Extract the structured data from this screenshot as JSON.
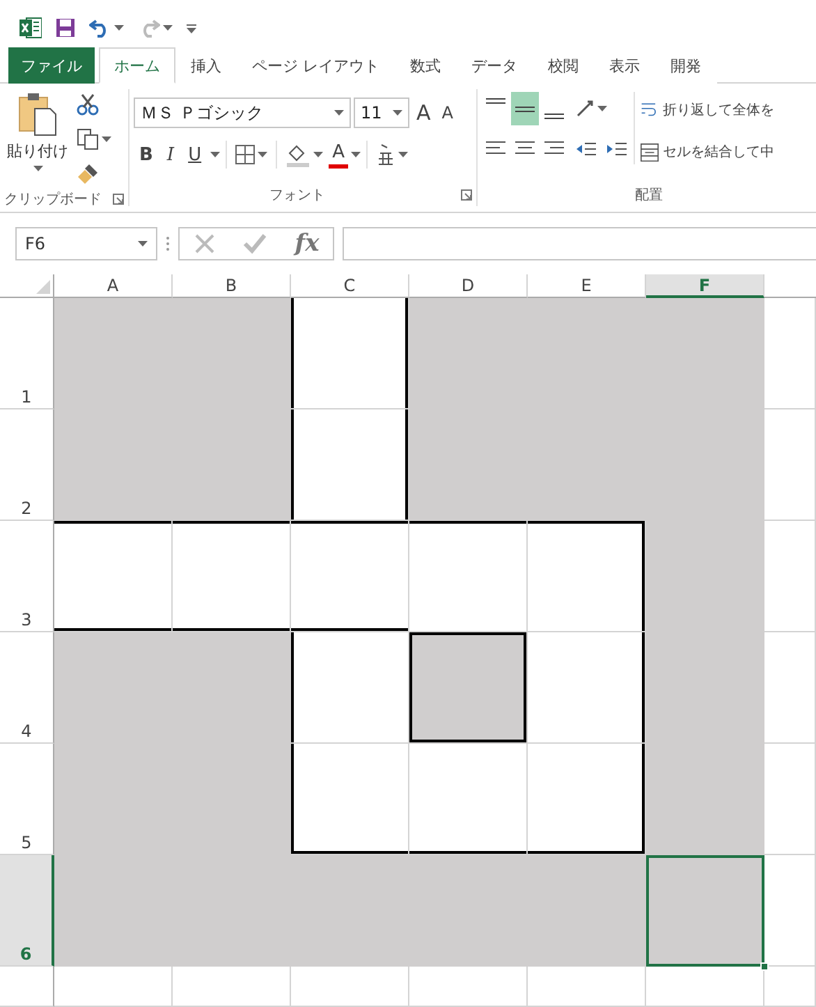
{
  "tabs": [
    {
      "label": "ファイル",
      "kind": "file",
      "selected": false
    },
    {
      "label": "ホーム",
      "kind": "tab",
      "selected": true
    },
    {
      "label": "挿入",
      "kind": "tab",
      "selected": false
    },
    {
      "label": "ページ レイアウト",
      "kind": "tab",
      "selected": false
    },
    {
      "label": "数式",
      "kind": "tab",
      "selected": false
    },
    {
      "label": "データ",
      "kind": "tab",
      "selected": false
    },
    {
      "label": "校閲",
      "kind": "tab",
      "selected": false
    },
    {
      "label": "表示",
      "kind": "tab",
      "selected": false
    },
    {
      "label": "開発",
      "kind": "tab",
      "selected": false
    }
  ],
  "clipboard": {
    "paste_label": "貼り付け",
    "group_label": "クリップボード"
  },
  "font": {
    "font_name": "ＭＳ Ｐゴシック",
    "font_size": "11",
    "grow": "A",
    "shrink": "A",
    "styles": [
      "B",
      "I",
      "U"
    ],
    "font_color_letter": "A",
    "group_label": "フォント"
  },
  "alignment": {
    "vertical": [
      {
        "selected": false
      },
      {
        "selected": true
      },
      {
        "selected": false
      }
    ],
    "wrap_text": "折り返して全体を",
    "merge_center": "セルを結合して中",
    "group_label": "配置"
  },
  "formula_bar": {
    "name_box": "F6",
    "function_label": "fx"
  },
  "columns": [
    {
      "label": "A",
      "selected": false
    },
    {
      "label": "B",
      "selected": false
    },
    {
      "label": "C",
      "selected": false
    },
    {
      "label": "D",
      "selected": false
    },
    {
      "label": "E",
      "selected": false
    },
    {
      "label": "F",
      "selected": true
    }
  ],
  "rows": [
    {
      "header": "1",
      "selected": false,
      "cells": [
        {
          "shaded": true,
          "selected": false,
          "border_top": false,
          "border_right": false,
          "border_bottom": false,
          "border_left": false
        },
        {
          "shaded": true,
          "selected": false,
          "border_top": false,
          "border_right": false,
          "border_bottom": false,
          "border_left": false
        },
        {
          "shaded": false,
          "selected": false,
          "border_top": false,
          "border_right": true,
          "border_bottom": false,
          "border_left": true
        },
        {
          "shaded": true,
          "selected": false,
          "border_top": false,
          "border_right": false,
          "border_bottom": false,
          "border_left": false
        },
        {
          "shaded": true,
          "selected": false,
          "border_top": false,
          "border_right": false,
          "border_bottom": false,
          "border_left": false
        },
        {
          "shaded": true,
          "selected": false,
          "border_top": false,
          "border_right": false,
          "border_bottom": false,
          "border_left": false
        }
      ]
    },
    {
      "header": "2",
      "selected": false,
      "cells": [
        {
          "shaded": true,
          "selected": false,
          "border_top": false,
          "border_right": false,
          "border_bottom": false,
          "border_left": false
        },
        {
          "shaded": true,
          "selected": false,
          "border_top": false,
          "border_right": false,
          "border_bottom": false,
          "border_left": false
        },
        {
          "shaded": false,
          "selected": false,
          "border_top": false,
          "border_right": true,
          "border_bottom": false,
          "border_left": true
        },
        {
          "shaded": true,
          "selected": false,
          "border_top": false,
          "border_right": false,
          "border_bottom": false,
          "border_left": false
        },
        {
          "shaded": true,
          "selected": false,
          "border_top": false,
          "border_right": false,
          "border_bottom": false,
          "border_left": false
        },
        {
          "shaded": true,
          "selected": false,
          "border_top": false,
          "border_right": false,
          "border_bottom": false,
          "border_left": false
        }
      ]
    },
    {
      "header": "3",
      "selected": false,
      "cells": [
        {
          "shaded": false,
          "selected": false,
          "border_top": true,
          "border_right": false,
          "border_bottom": true,
          "border_left": false
        },
        {
          "shaded": false,
          "selected": false,
          "border_top": true,
          "border_right": false,
          "border_bottom": true,
          "border_left": false
        },
        {
          "shaded": false,
          "selected": false,
          "border_top": true,
          "border_right": false,
          "border_bottom": true,
          "border_left": false
        },
        {
          "shaded": false,
          "selected": false,
          "border_top": true,
          "border_right": false,
          "border_bottom": false,
          "border_left": false
        },
        {
          "shaded": false,
          "selected": false,
          "border_top": true,
          "border_right": true,
          "border_bottom": false,
          "border_left": false
        },
        {
          "shaded": true,
          "selected": false,
          "border_top": false,
          "border_right": false,
          "border_bottom": false,
          "border_left": false
        }
      ]
    },
    {
      "header": "4",
      "selected": false,
      "cells": [
        {
          "shaded": true,
          "selected": false,
          "border_top": false,
          "border_right": false,
          "border_bottom": false,
          "border_left": false
        },
        {
          "shaded": true,
          "selected": false,
          "border_top": false,
          "border_right": false,
          "border_bottom": false,
          "border_left": false
        },
        {
          "shaded": false,
          "selected": false,
          "border_top": false,
          "border_right": false,
          "border_bottom": false,
          "border_left": true
        },
        {
          "shaded": true,
          "selected": false,
          "border_top": true,
          "border_right": true,
          "border_bottom": true,
          "border_left": true
        },
        {
          "shaded": false,
          "selected": false,
          "border_top": false,
          "border_right": true,
          "border_bottom": false,
          "border_left": false
        },
        {
          "shaded": true,
          "selected": false,
          "border_top": false,
          "border_right": false,
          "border_bottom": false,
          "border_left": false
        }
      ]
    },
    {
      "header": "5",
      "selected": false,
      "cells": [
        {
          "shaded": true,
          "selected": false,
          "border_top": false,
          "border_right": false,
          "border_bottom": false,
          "border_left": false
        },
        {
          "shaded": true,
          "selected": false,
          "border_top": false,
          "border_right": false,
          "border_bottom": false,
          "border_left": false
        },
        {
          "shaded": false,
          "selected": false,
          "border_top": false,
          "border_right": false,
          "border_bottom": true,
          "border_left": true
        },
        {
          "shaded": false,
          "selected": false,
          "border_top": false,
          "border_right": false,
          "border_bottom": true,
          "border_left": false
        },
        {
          "shaded": false,
          "selected": false,
          "border_top": false,
          "border_right": true,
          "border_bottom": true,
          "border_left": false
        },
        {
          "shaded": true,
          "selected": false,
          "border_top": false,
          "border_right": false,
          "border_bottom": false,
          "border_left": false
        }
      ]
    },
    {
      "header": "6",
      "selected": true,
      "cells": [
        {
          "shaded": true,
          "selected": false,
          "border_top": false,
          "border_right": false,
          "border_bottom": false,
          "border_left": false
        },
        {
          "shaded": true,
          "selected": false,
          "border_top": false,
          "border_right": false,
          "border_bottom": false,
          "border_left": false
        },
        {
          "shaded": true,
          "selected": false,
          "border_top": false,
          "border_right": false,
          "border_bottom": false,
          "border_left": false
        },
        {
          "shaded": true,
          "selected": false,
          "border_top": false,
          "border_right": false,
          "border_bottom": false,
          "border_left": false
        },
        {
          "shaded": true,
          "selected": false,
          "border_top": false,
          "border_right": false,
          "border_bottom": false,
          "border_left": false
        },
        {
          "shaded": true,
          "selected": true,
          "border_top": false,
          "border_right": false,
          "border_bottom": false,
          "border_left": false
        }
      ]
    }
  ]
}
